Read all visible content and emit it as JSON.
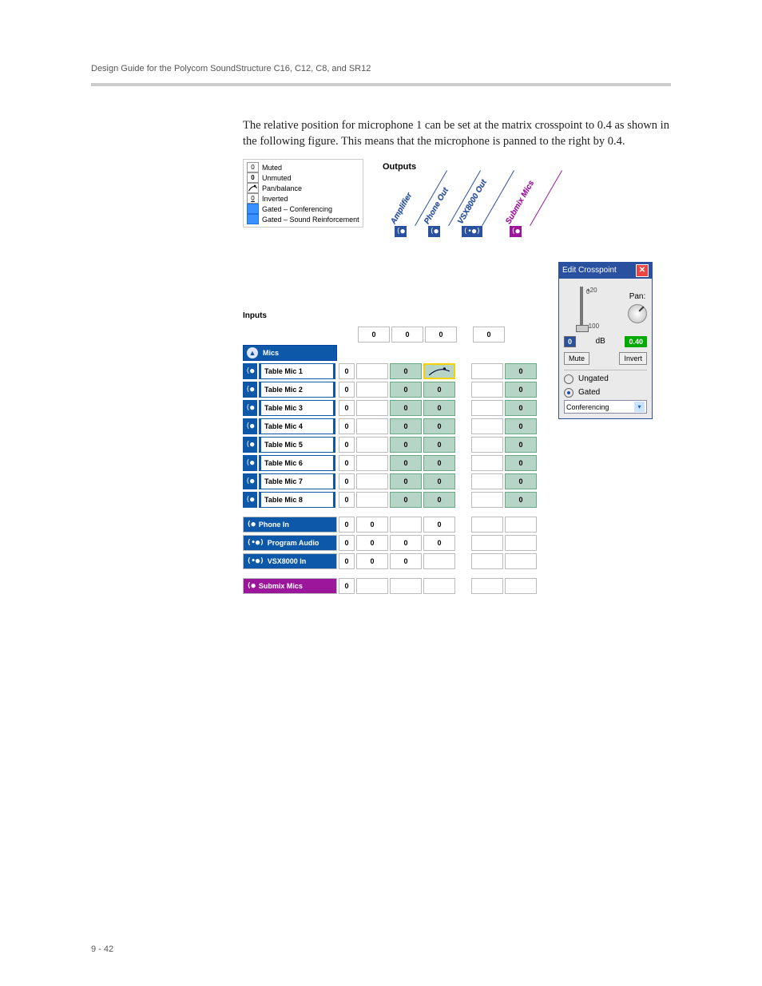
{
  "page_header": "Design Guide for the Polycom SoundStructure C16, C12, C8, and SR12",
  "page_footer": "9 - 42",
  "paragraph": "The relative position for microphone 1 can be set at the matrix crosspoint to 0.4 as shown in the following figure. This means that the microphone is panned to the right by 0.4.",
  "legend": [
    {
      "swatch": "0",
      "label": "Muted"
    },
    {
      "swatch": "0",
      "label": "Unmuted",
      "style": "bold"
    },
    {
      "swatch": "arc",
      "label": "Pan/balance"
    },
    {
      "swatch": "0",
      "label": "Inverted",
      "style": "underline"
    },
    {
      "swatch": "blue",
      "label": "Gated – Conferencing"
    },
    {
      "swatch": "blue",
      "label": "Gated – Sound Reinforcement"
    }
  ],
  "outputs_label": "Outputs",
  "inputs_label": "Inputs",
  "output_columns": [
    {
      "name": "Amplifier",
      "type": "mono",
      "color": "#2a50a0",
      "fader": "0"
    },
    {
      "name": "Phone Out",
      "type": "mono",
      "color": "#2a50a0",
      "fader": "0"
    },
    {
      "name": "VSX8000 Out",
      "type": "stereo",
      "color": "#2a50a0",
      "fader": "0"
    },
    {
      "name": "Submix Mics",
      "type": "mono",
      "color": "#9c169c",
      "fader": "0"
    }
  ],
  "mics_group": {
    "title": "Mics",
    "rows": [
      {
        "name": "Table Mic 1",
        "fader": "0",
        "cells": [
          "",
          "0",
          "arc",
          "",
          "0"
        ],
        "highlight": 2
      },
      {
        "name": "Table Mic 2",
        "fader": "0",
        "cells": [
          "",
          "0",
          "0",
          "",
          "0"
        ]
      },
      {
        "name": "Table Mic 3",
        "fader": "0",
        "cells": [
          "",
          "0",
          "0",
          "",
          "0"
        ]
      },
      {
        "name": "Table Mic 4",
        "fader": "0",
        "cells": [
          "",
          "0",
          "0",
          "",
          "0"
        ]
      },
      {
        "name": "Table Mic 5",
        "fader": "0",
        "cells": [
          "",
          "0",
          "0",
          "",
          "0"
        ]
      },
      {
        "name": "Table Mic 6",
        "fader": "0",
        "cells": [
          "",
          "0",
          "0",
          "",
          "0"
        ]
      },
      {
        "name": "Table Mic 7",
        "fader": "0",
        "cells": [
          "",
          "0",
          "0",
          "",
          "0"
        ]
      },
      {
        "name": "Table Mic 8",
        "fader": "0",
        "cells": [
          "",
          "0",
          "0",
          "",
          "0"
        ]
      }
    ]
  },
  "other_inputs": [
    {
      "name": "Phone In",
      "fader": "0",
      "color": "blue",
      "cells": [
        "0",
        "",
        "0",
        "",
        ""
      ]
    },
    {
      "name": "Program Audio",
      "fader": "0",
      "color": "blue",
      "stereo": true,
      "cells": [
        "0",
        "0",
        "0",
        "",
        ""
      ]
    },
    {
      "name": "VSX8000 In",
      "fader": "0",
      "color": "blue",
      "stereo": true,
      "cells": [
        "0",
        "0",
        "",
        "",
        ""
      ]
    }
  ],
  "submix_row": {
    "name": "Submix Mics",
    "fader": "0",
    "color": "purple",
    "cells": [
      "",
      "",
      "",
      "",
      ""
    ]
  },
  "popup": {
    "title": "Edit Crosspoint",
    "slider_top": "+20",
    "slider_mid": "0",
    "slider_bot": "-100",
    "pan_label": "Pan:",
    "gain_db": "0",
    "gain_unit": "dB",
    "pan_value": "0.40",
    "mute_btn": "Mute",
    "invert_btn": "Invert",
    "ungated": "Ungated",
    "gated": "Gated",
    "dropdown": "Conferencing"
  }
}
